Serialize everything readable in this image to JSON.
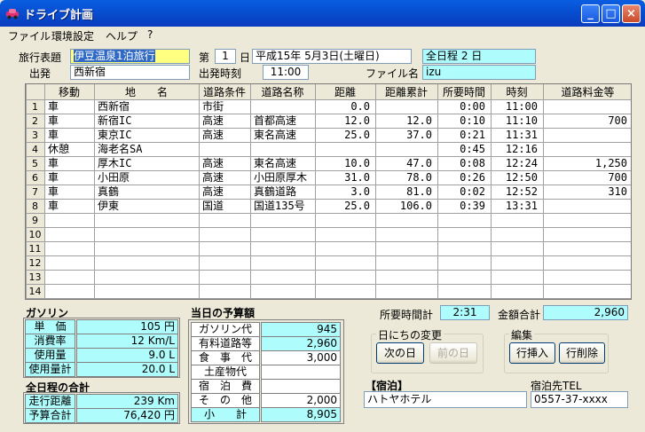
{
  "window": {
    "title": "ドライブ計画"
  },
  "menu": [
    "ファイル",
    "環境設定",
    "ヘルプ",
    "?"
  ],
  "header": {
    "trip_label": "旅行表題",
    "trip_value": "伊豆温泉1泊旅行",
    "day_prefix": "第",
    "day_number": "1",
    "day_suffix": "日",
    "date_value": "平成15年 5月3日(土曜日)",
    "total_days": "全日程  2 日",
    "departure_label": "出発",
    "departure_value": "西新宿",
    "depart_time_label": "出発時刻",
    "depart_time_value": "11:00",
    "file_label": "ファイル名",
    "file_value": "izu"
  },
  "table": {
    "columns": [
      "移動",
      "地　　名",
      "道路条件",
      "道路名称",
      "距離",
      "距離累計",
      "所要時間",
      "時刻",
      "道路料金等"
    ],
    "rows": [
      [
        "車",
        "西新宿",
        "市街",
        "",
        "0.0",
        "",
        "0:00",
        "11:00",
        ""
      ],
      [
        "車",
        "新宿IC",
        "高速",
        "首都高速",
        "12.0",
        "12.0",
        "0:10",
        "11:10",
        "700"
      ],
      [
        "車",
        "東京IC",
        "高速",
        "東名高速",
        "25.0",
        "37.0",
        "0:21",
        "11:31",
        ""
      ],
      [
        "休憩",
        "海老名SA",
        "",
        "",
        "",
        "",
        "0:45",
        "12:16",
        ""
      ],
      [
        "車",
        "厚木IC",
        "高速",
        "東名高速",
        "10.0",
        "47.0",
        "0:08",
        "12:24",
        "1,250"
      ],
      [
        "車",
        "小田原",
        "高速",
        "小田原厚木",
        "31.0",
        "78.0",
        "0:26",
        "12:50",
        "700"
      ],
      [
        "車",
        "真鶴",
        "高速",
        "真鶴道路",
        "3.0",
        "81.0",
        "0:02",
        "12:52",
        "310"
      ],
      [
        "車",
        "伊東",
        "国道",
        "国道135号",
        "25.0",
        "106.0",
        "0:39",
        "13:31",
        ""
      ],
      [
        "",
        "",
        "",
        "",
        "",
        "",
        "",
        "",
        ""
      ],
      [
        "",
        "",
        "",
        "",
        "",
        "",
        "",
        "",
        ""
      ],
      [
        "",
        "",
        "",
        "",
        "",
        "",
        "",
        "",
        ""
      ],
      [
        "",
        "",
        "",
        "",
        "",
        "",
        "",
        "",
        ""
      ],
      [
        "",
        "",
        "",
        "",
        "",
        "",
        "",
        "",
        ""
      ],
      [
        "",
        "",
        "",
        "",
        "",
        "",
        "",
        "",
        ""
      ]
    ],
    "row_numbers": [
      "1",
      "2",
      "3",
      "4",
      "5",
      "6",
      "7",
      "8",
      "9",
      "10",
      "11",
      "12",
      "13",
      "14"
    ]
  },
  "gasoline": {
    "title": "ガソリン",
    "unit_price_label": "単　価",
    "unit_price_value": "105 円",
    "consumption_label": "消費率",
    "consumption_value": "12 Km/L",
    "usage_label": "使用量",
    "usage_value": "9.0  L",
    "usage_total_label": "使用量計",
    "usage_total_value": "20.0  L"
  },
  "trip_total": {
    "title": "全日程の合計",
    "distance_label": "走行距離",
    "distance_value": "239 Km",
    "budget_label": "予算合計",
    "budget_value": "76,420 円"
  },
  "budget": {
    "title": "当日の予算額",
    "gas_label": "ガソリン代",
    "gas_value": "945",
    "toll_label": "有料道路等",
    "toll_value": "2,960",
    "food_label": "食　事　代",
    "food_value": "3,000",
    "souvenir_label": "土産物代",
    "souvenir_value": "",
    "lodging_label": "宿　泊　費",
    "lodging_value": "",
    "other_label": "そ　の　他",
    "other_value": "2,000",
    "subtotal_label": "小　　計",
    "subtotal_value": "8,905"
  },
  "summary": {
    "time_total_label": "所要時間計",
    "time_total_value": "2:31",
    "amount_total_label": "金額合計",
    "amount_total_value": "2,960"
  },
  "day_change": {
    "title": "日にちの変更",
    "next": "次の日",
    "prev": "前の日"
  },
  "edit": {
    "title": "編集",
    "insert": "行挿入",
    "delete": "行削除"
  },
  "lodging": {
    "label": "【宿泊】",
    "value": "ハトヤホテル",
    "tel_label": "宿泊先TEL",
    "tel_value": "0557-37-xxxx"
  }
}
